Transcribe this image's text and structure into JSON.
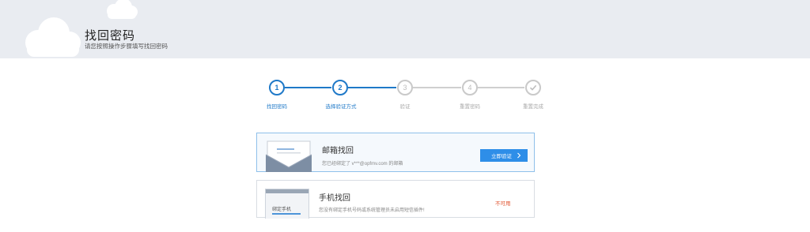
{
  "header": {
    "title": "找回密码",
    "subtitle": "请您按照操作步骤填写找回密码"
  },
  "stepper": {
    "steps": [
      {
        "index": "1",
        "label": "找回密码",
        "state": "active"
      },
      {
        "index": "2",
        "label": "选择验证方式",
        "state": "active"
      },
      {
        "index": "3",
        "label": "验证",
        "state": "todo"
      },
      {
        "index": "4",
        "label": "重置密码",
        "state": "todo"
      },
      {
        "index": "",
        "label": "重置完成",
        "state": "todo",
        "icon": "check-icon"
      }
    ]
  },
  "options": {
    "email": {
      "title": "邮箱找回",
      "description": "您已经绑定了 v***@opfmv.com 的邮箱",
      "button_label": "立即验证",
      "button_icon": "chevron-right-icon"
    },
    "phone": {
      "title": "手机找回",
      "illustration_label": "绑定手机",
      "description": "您没有绑定手机号码或系统管理员未启用短信插件!",
      "status": "不可用"
    }
  },
  "colors": {
    "accent": "#1f79c8",
    "button": "#2e8ee8",
    "inactive": "#c9c9c9",
    "warning": "#e0532f",
    "header_bg": "#e9ecf1"
  }
}
